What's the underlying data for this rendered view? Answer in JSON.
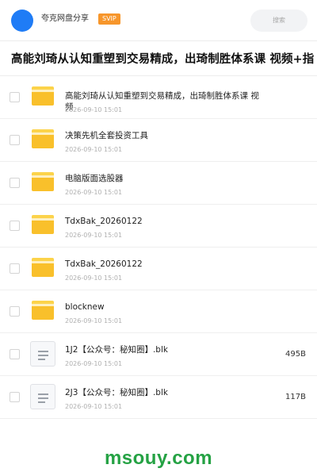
{
  "header": {
    "share_title": "夸克网盘分享",
    "badge": "SVIP",
    "search_placeholder": "搜索"
  },
  "folder_title": "高能刘琦从认知重塑到交易精成，出琦制胜体系课 视频+指",
  "items": [
    {
      "type": "folder",
      "name": "高能刘琦从认知重塑到交易精成，出琦制胜体系课 视频",
      "date": "2026-09-10 15:01",
      "size": ""
    },
    {
      "type": "folder",
      "name": "决策先机全套投资工具",
      "date": "2026-09-10 15:01",
      "size": ""
    },
    {
      "type": "folder",
      "name": "电脑版面选股器",
      "date": "2026-09-10 15:01",
      "size": ""
    },
    {
      "type": "folder",
      "name": "TdxBak_20260122",
      "date": "2026-09-10 15:01",
      "size": ""
    },
    {
      "type": "folder",
      "name": "TdxBak_20260122",
      "date": "2026-09-10 15:01",
      "size": ""
    },
    {
      "type": "folder",
      "name": "blocknew",
      "date": "2026-09-10 15:01",
      "size": ""
    },
    {
      "type": "file",
      "name": "1J2【公众号：秘知圈】.blk",
      "date": "2026-09-10 15:01",
      "size": "495B"
    },
    {
      "type": "file",
      "name": "2J3【公众号：秘知圈】.blk",
      "date": "2026-09-10 15:01",
      "size": "117B"
    }
  ],
  "watermark": "msouy.com",
  "colors": {
    "avatar": "#1f7cf6",
    "badge": "#f7962b",
    "folder": "#f9c02b",
    "watermark": "#25a244"
  }
}
